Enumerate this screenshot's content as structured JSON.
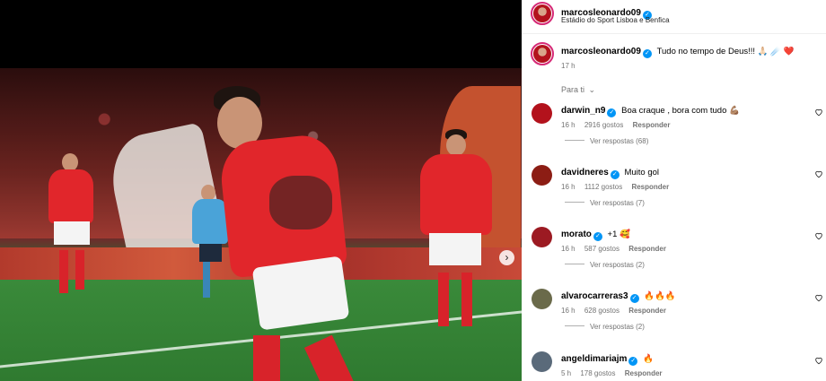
{
  "post": {
    "username": "marcosleonardo09",
    "location": "Estádio do Sport Lisboa e Benfica",
    "caption": "Tudo no tempo de Deus!!! 🙏🏻 ☄️ ❤️",
    "caption_time": "17 h"
  },
  "sort_label": "Para ti",
  "comments": [
    {
      "username": "darwin_n9",
      "verified": true,
      "text": "Boa craque , bora com tudo 💪🏽",
      "time": "16 h",
      "likes": "2916 gostos",
      "reply": "Responder",
      "replies": "Ver respostas (68)",
      "avatar_color": "#b3121c"
    },
    {
      "username": "davidneres",
      "verified": true,
      "text": "Muito gol",
      "time": "16 h",
      "likes": "1112 gostos",
      "reply": "Responder",
      "replies": "Ver respostas (7)",
      "avatar_color": "#8c1d14"
    },
    {
      "username": "morato",
      "verified": true,
      "text": "+1 🥰",
      "time": "16 h",
      "likes": "587 gostos",
      "reply": "Responder",
      "replies": "Ver respostas (2)",
      "avatar_color": "#9c1a22"
    },
    {
      "username": "alvarocarreras3",
      "verified": true,
      "text": "🔥🔥🔥",
      "time": "16 h",
      "likes": "628 gostos",
      "reply": "Responder",
      "replies": "Ver respostas (2)",
      "avatar_color": "#6a6a4a"
    },
    {
      "username": "angeldimariajm",
      "verified": true,
      "text": "🔥",
      "time": "5 h",
      "likes": "178 gostos",
      "reply": "Responder",
      "replies": "",
      "avatar_color": "#5a6a7a"
    }
  ],
  "icons": {
    "verified": "✓",
    "next": "›",
    "more": "…",
    "chevron": "⌄"
  },
  "colors": {
    "verified_blue": "#0095f6",
    "story_ring": "#d62976",
    "benfica_red": "#e1262b"
  }
}
